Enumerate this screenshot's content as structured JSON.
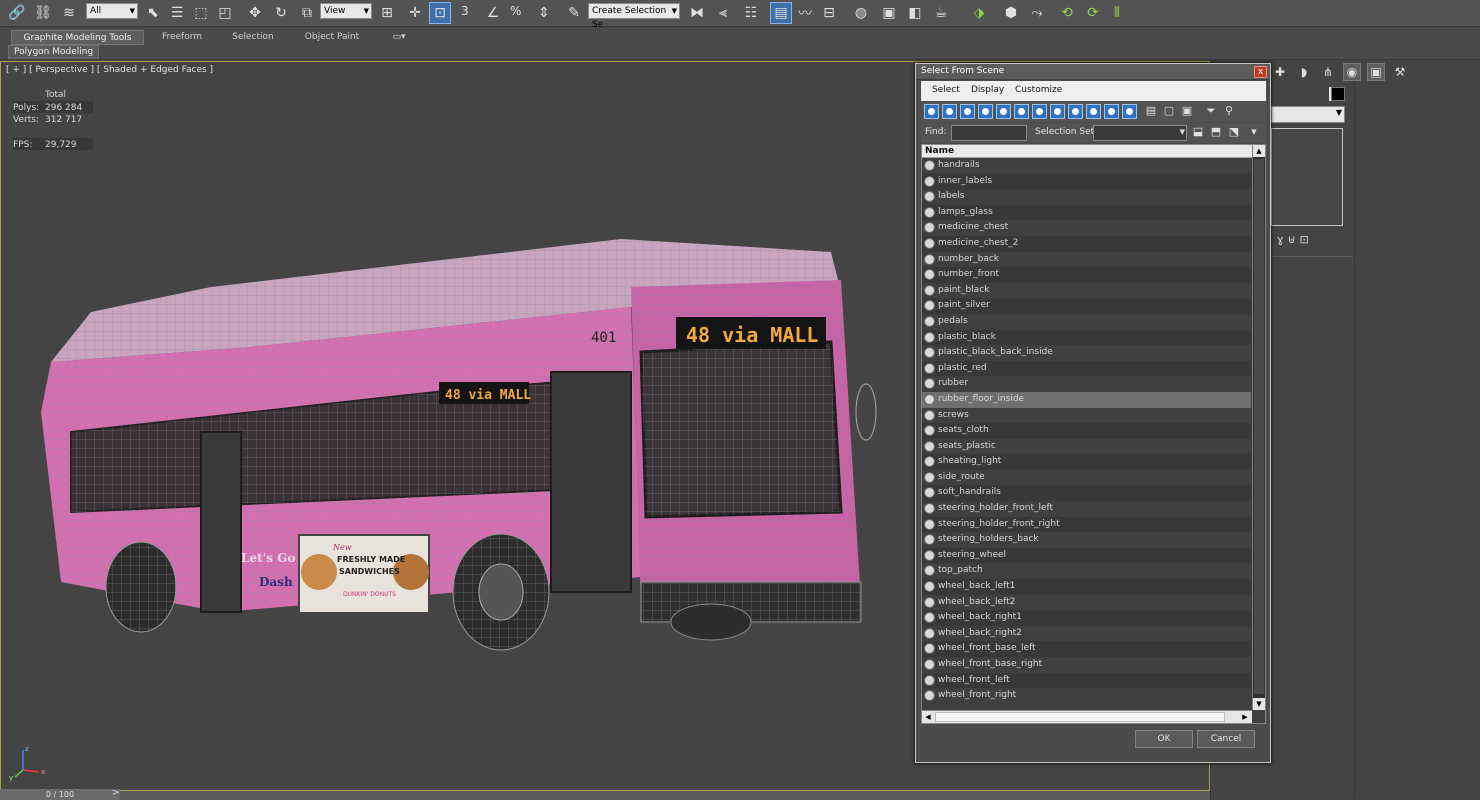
{
  "toolbar": {
    "filter_value": "All",
    "refcoord_value": "View",
    "selection_set_value": "Create Selection Se",
    "snap_label": "3",
    "percent_label": "%"
  },
  "ribbon": {
    "tabs": [
      "Graphite Modeling Tools",
      "Freeform",
      "Selection",
      "Object Paint"
    ],
    "sub_label": "Polygon Modeling"
  },
  "viewport": {
    "label": "[ + ] [ Perspective ] [ Shaded + Edged Faces ]",
    "stats": {
      "total_label": "Total",
      "polys_label": "Polys:",
      "polys_value": "296 284",
      "verts_label": "Verts:",
      "verts_value": "312 717",
      "fps_label": "FPS:",
      "fps_value": "29,729"
    },
    "bus": {
      "destination_sign": "48 via MALL",
      "side_sign": "48 via MALL",
      "fleet_number": "401",
      "ad_line1": "FRESHLY MADE",
      "ad_line2": "SANDWICHES",
      "ad_new": "New",
      "ad_brand": "DUNKIN' DONUTS",
      "side_text1": "Let's Go",
      "side_text2": "Dash"
    },
    "axis": {
      "x": "x",
      "y": "y",
      "z": "z"
    }
  },
  "timeline": {
    "frame_counter": "0 / 100",
    "next_symbol": ">"
  },
  "dialog": {
    "title": "Select From Scene",
    "close_symbol": "x",
    "menu": [
      "Select",
      "Display",
      "Customize"
    ],
    "find_label": "Find:",
    "find_value": "",
    "selection_set_label": "Selection Set:",
    "column_header": "Name",
    "selected_item": "rubber_floor_inside",
    "objects": [
      "handrails",
      "inner_labels",
      "labels",
      "lamps_glass",
      "medicine_chest",
      "medicine_chest_2",
      "number_back",
      "number_front",
      "paint_black",
      "paint_silver",
      "pedals",
      "plastic_black",
      "plastic_black_back_inside",
      "plastic_red",
      "rubber",
      "rubber_floor_inside",
      "screws",
      "seats_cloth",
      "seats_plastic",
      "sheating_light",
      "side_route",
      "soft_handrails",
      "steering_holder_front_left",
      "steering_holder_front_right",
      "steering_holders_back",
      "steering_wheel",
      "top_patch",
      "wheel_back_left1",
      "wheel_back_left2",
      "wheel_back_right1",
      "wheel_back_right2",
      "wheel_front_base_left",
      "wheel_front_base_right",
      "wheel_front_left",
      "wheel_front_right"
    ],
    "ok_label": "OK",
    "cancel_label": "Cancel"
  },
  "colors": {
    "bus_body": "#d46fb2",
    "sign_amber": "#f2a93b",
    "stats_yellow": "#e5cf63",
    "selection_blue": "#2f72c0",
    "close_red": "#c23a2b"
  }
}
